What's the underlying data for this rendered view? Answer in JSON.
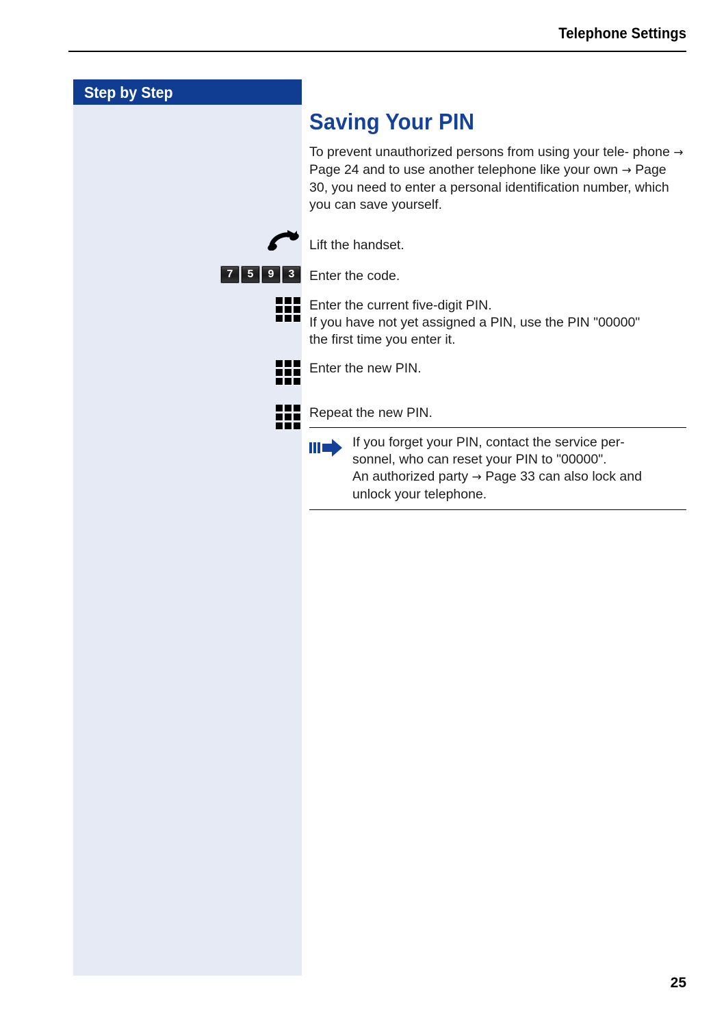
{
  "header": {
    "title": "Telephone Settings"
  },
  "sidebar": {
    "banner_label": "Step by Step"
  },
  "main": {
    "section_title": "Saving Your PIN",
    "intro_line1": "To prevent unauthorized persons from using your tele-",
    "intro_line2_a": "phone",
    "intro_arrow1": "→",
    "intro_line2_b": "Page 24 and to use another telephone like",
    "intro_line3_a": "your own",
    "intro_arrow2": "→",
    "intro_line3_b": "Page 30, you need to enter a personal",
    "intro_line4": "identification number, which you can save yourself."
  },
  "steps": [
    {
      "icon": "handset-icon",
      "text_lines": [
        "Lift the handset."
      ]
    },
    {
      "icon": "keycode-icon",
      "keys": [
        "7",
        "5",
        "9",
        "3"
      ],
      "text_lines": [
        "Enter the code."
      ]
    },
    {
      "icon": "keypad-icon",
      "text_lines": [
        "Enter the current five-digit PIN.",
        "If you have not yet assigned a PIN, use the PIN \"00000\"",
        "the first time you enter it."
      ]
    },
    {
      "icon": "keypad-icon",
      "text_lines": [
        "Enter the new PIN."
      ]
    },
    {
      "icon": "keypad-icon",
      "text_lines": [
        "Repeat the new PIN."
      ]
    }
  ],
  "note": {
    "icon": "blue-arrow-icon",
    "line1": "If you forget your PIN, contact the service per-",
    "line2": "sonnel, who can reset your PIN to \"00000\".",
    "line3_a": "An authorized party",
    "line3_arrow": "→",
    "line3_b": "Page 33 can also lock and",
    "line4": "unlock your telephone."
  },
  "footer": {
    "page_number": "25"
  },
  "colors": {
    "banner_blue": "#103d91",
    "sidebar_fill": "#e6eaf5",
    "heading_blue": "#14429b",
    "note_arrow_blue": "#14429b",
    "text": "#1a1a1a"
  }
}
